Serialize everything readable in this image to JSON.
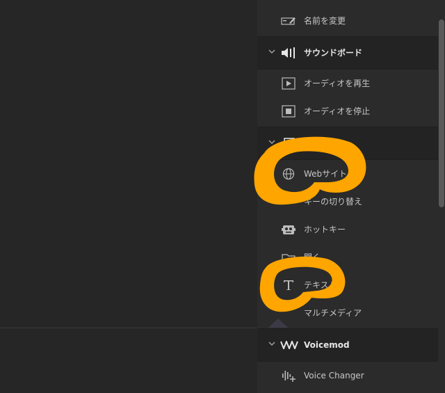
{
  "panel": {
    "items_top": [
      {
        "label": "名前を変更",
        "icon": "rename-icon"
      }
    ],
    "soundboard": {
      "title": "サウンドボード",
      "icon": "speaker-icon",
      "items": [
        {
          "label": "オーディオを再生",
          "icon": "play-icon"
        },
        {
          "label": "オーディオを停止",
          "icon": "stop-icon"
        }
      ]
    },
    "system_items": [
      {
        "label": "Webサイト",
        "icon": "globe-icon"
      },
      {
        "label": "キーの切り替え",
        "icon": "key-toggle-icon"
      },
      {
        "label": "ホットキー",
        "icon": "robot-icon"
      },
      {
        "label": "開く",
        "icon": "open-icon"
      },
      {
        "label": "テキスト",
        "icon": "text-icon"
      },
      {
        "label": "マルチメディア",
        "icon": "multimedia-icon"
      }
    ],
    "voicemod": {
      "title": "Voicemod",
      "icon": "voicemod-logo-icon",
      "items": [
        {
          "label": "Voice Changer",
          "icon": "voice-changer-icon"
        }
      ]
    }
  },
  "colors": {
    "highlight": "#FFA500",
    "panel_bg": "#2b2b2b",
    "group_bg": "#232323",
    "canvas_bg": "#262626"
  }
}
